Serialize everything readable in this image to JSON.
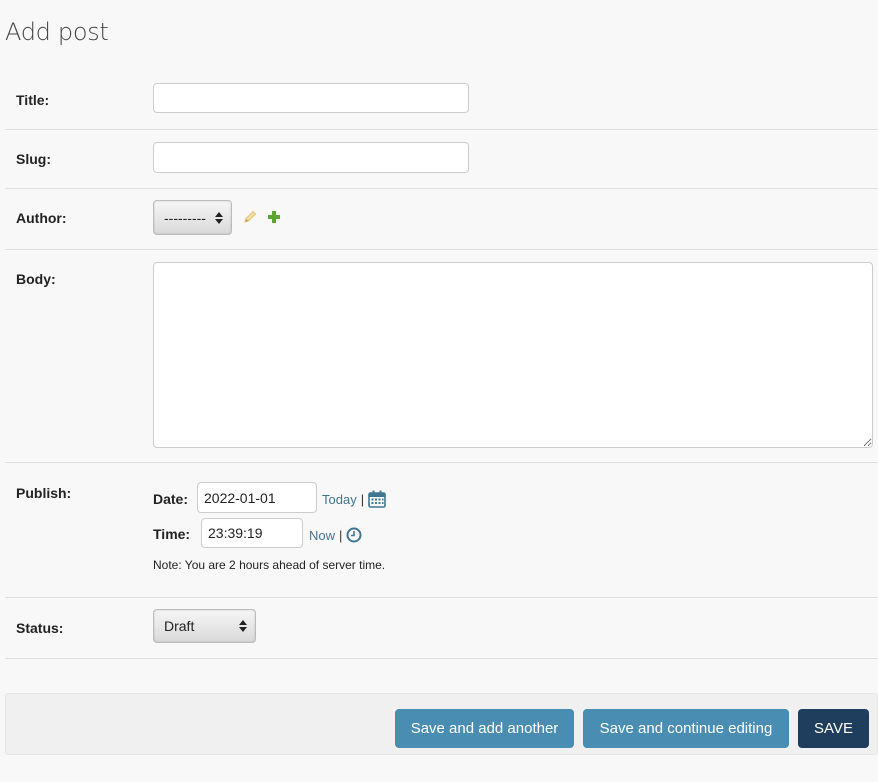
{
  "page": {
    "title": "Add post"
  },
  "fields": {
    "title": {
      "label": "Title:",
      "value": ""
    },
    "slug": {
      "label": "Slug:",
      "value": ""
    },
    "author": {
      "label": "Author:",
      "selected": "---------"
    },
    "body": {
      "label": "Body:",
      "value": ""
    },
    "publish": {
      "label": "Publish:",
      "date_label": "Date:",
      "date_value": "2022-01-01",
      "today_link": "Today",
      "separator": "|",
      "time_label": "Time:",
      "time_value": "23:39:19",
      "now_link": "Now",
      "note": "Note: You are 2 hours ahead of server time."
    },
    "status": {
      "label": "Status:",
      "selected": "Draft"
    }
  },
  "actions": {
    "save_add_another": "Save and add another",
    "save_continue": "Save and continue editing",
    "save": "SAVE"
  },
  "colors": {
    "link": "#417690",
    "secondary_button": "#4a8db3",
    "primary_button": "#1f3d5c",
    "add_icon": "#5aa532",
    "edit_icon": "#e8c77a"
  },
  "icons": {
    "edit": "pencil-icon",
    "add": "plus-icon",
    "calendar": "calendar-icon",
    "clock": "clock-icon"
  }
}
